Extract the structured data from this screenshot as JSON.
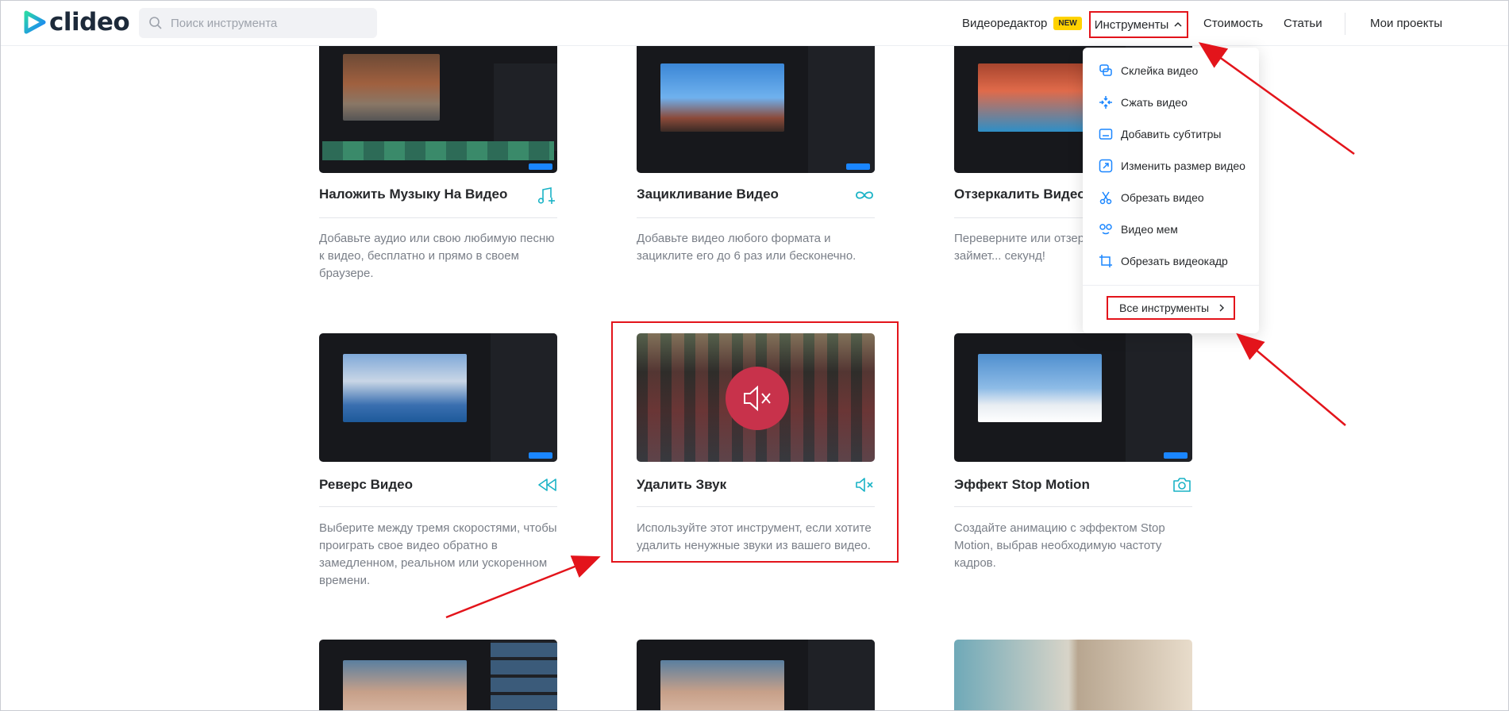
{
  "header": {
    "logo_text": "clideo",
    "search_placeholder": "Поиск инструмента",
    "nav": {
      "editor": "Видеоредактор",
      "new_badge": "NEW",
      "tools": "Инструменты",
      "pricing": "Стоимость",
      "articles": "Статьи",
      "projects": "Мои проекты"
    }
  },
  "dropdown": {
    "items": [
      {
        "label": "Склейка видео",
        "icon": "merge-icon"
      },
      {
        "label": "Сжать видео",
        "icon": "compress-icon"
      },
      {
        "label": "Добавить субтитры",
        "icon": "subtitles-icon"
      },
      {
        "label": "Изменить размер видео",
        "icon": "resize-icon"
      },
      {
        "label": "Обрезать видео",
        "icon": "scissors-icon"
      },
      {
        "label": "Видео мем",
        "icon": "meme-icon"
      },
      {
        "label": "Обрезать видеокадр",
        "icon": "crop-icon"
      }
    ],
    "all_tools": "Все инструменты"
  },
  "cards": [
    {
      "title": "Наложить Музыку На Видео",
      "icon": "music-add-icon",
      "desc": "Добавьте аудио или свою любимую песню к видео, бесплатно и прямо в своем браузере."
    },
    {
      "title": "Зацикливание Видео",
      "icon": "infinity-icon",
      "desc": "Добавьте видео любого формата и зациклите его до 6 раз или бесконечно."
    },
    {
      "title": "Отзеркалить Видео",
      "icon": "mirror-icon",
      "desc": "Переверните или отзер... в один клик. Это займет... секунд!"
    },
    {
      "title": "Реверс Видео",
      "icon": "rewind-icon",
      "desc": "Выберите между тремя скоростями, чтобы проиграть свое видео обратно в замедленном, реальном или ускоренном времени."
    },
    {
      "title": "Удалить Звук",
      "icon": "mute-icon",
      "desc": "Используйте этот инструмент, если хотите удалить ненужные звуки из вашего видео."
    },
    {
      "title": "Эффект Stop Motion",
      "icon": "camera-icon",
      "desc": "Создайте анимацию с эффектом Stop Motion, выбрав необходимую частоту кадров."
    }
  ],
  "colors": {
    "accent": "#1ab3c6",
    "highlight": "#e3141b",
    "mute_circle": "#c8324b",
    "editor_blue": "#1a86ff"
  }
}
